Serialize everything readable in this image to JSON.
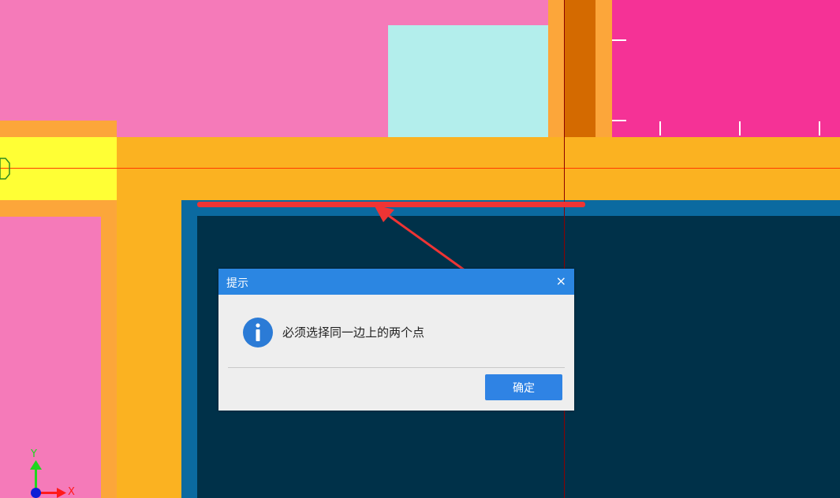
{
  "dialog": {
    "title": "提示",
    "close_glyph": "×",
    "message": "必须选择同一边上的两个点",
    "ok_label": "确定",
    "icon": "info-icon"
  },
  "axis": {
    "y_label": "Y",
    "x_label": "X"
  },
  "colors": {
    "dialog_header": "#2b86e2",
    "ok_button": "#2f83e4",
    "info_icon": "#2b7bd6",
    "annotation": "#ef3434",
    "canvas_navy": "#003149",
    "wall_orange": "#fbb221",
    "room_pink": "#f57ab9",
    "room_magenta": "#f53296",
    "room_cyan": "#b3eeec",
    "beam_yellow": "#ffff35"
  }
}
